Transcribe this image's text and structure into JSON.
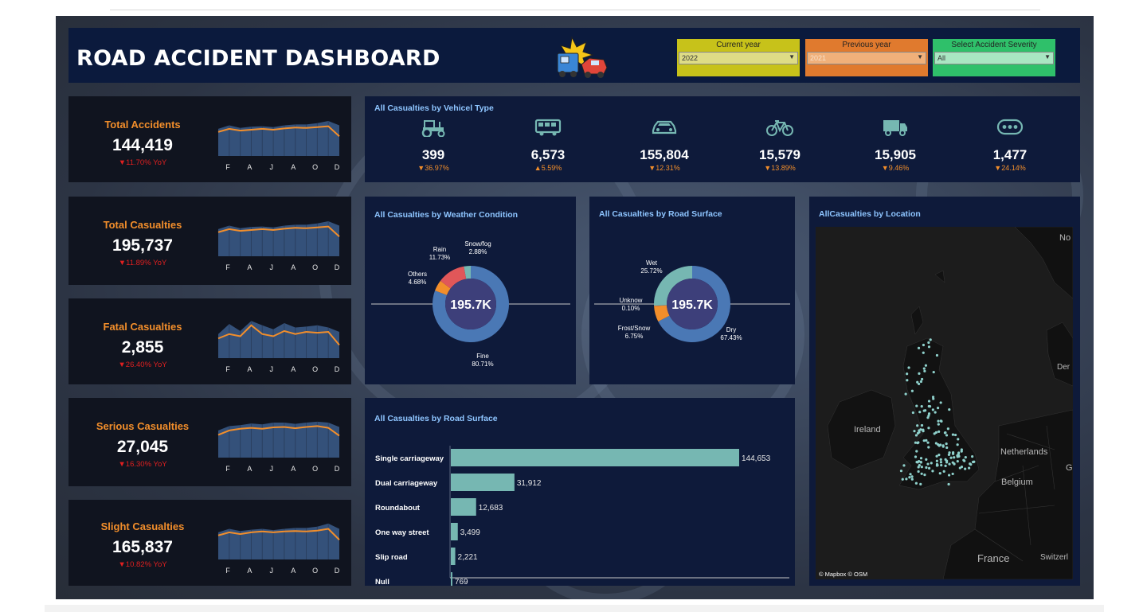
{
  "title": "ROAD ACCIDENT DASHBOARD",
  "header_icon": "car-crash-icon",
  "filters": [
    {
      "label": "Current year",
      "value": "2022",
      "color": "#c7c21a"
    },
    {
      "label": "Previous year",
      "value": "2021",
      "color": "#e07a2e"
    },
    {
      "label": "Select Accident Severity",
      "value": "All",
      "color": "#2fc06a"
    }
  ],
  "kpis": [
    {
      "title": "Total Accidents",
      "value": "144,419",
      "yoy": "▼11.70%  YoY",
      "trend": [
        0.55,
        0.62,
        0.58,
        0.6,
        0.62,
        0.6,
        0.63,
        0.65,
        0.64,
        0.66,
        0.68,
        0.45
      ],
      "area": [
        0.62,
        0.7,
        0.64,
        0.67,
        0.68,
        0.66,
        0.7,
        0.72,
        0.72,
        0.75,
        0.8,
        0.7
      ]
    },
    {
      "title": "Total Casualties",
      "value": "195,737",
      "yoy": "▼11.89%  YoY",
      "trend": [
        0.55,
        0.62,
        0.58,
        0.6,
        0.62,
        0.6,
        0.63,
        0.65,
        0.64,
        0.66,
        0.68,
        0.45
      ],
      "area": [
        0.62,
        0.7,
        0.64,
        0.67,
        0.68,
        0.66,
        0.7,
        0.72,
        0.72,
        0.75,
        0.8,
        0.7
      ]
    },
    {
      "title": "Fatal Casualties",
      "value": "2,855",
      "yoy": "▼26.40%  YoY",
      "trend": [
        0.45,
        0.55,
        0.5,
        0.75,
        0.55,
        0.5,
        0.62,
        0.55,
        0.6,
        0.58,
        0.6,
        0.3
      ],
      "area": [
        0.55,
        0.78,
        0.62,
        0.85,
        0.75,
        0.66,
        0.8,
        0.7,
        0.72,
        0.75,
        0.7,
        0.6
      ]
    },
    {
      "title": "Serious Casualties",
      "value": "27,045",
      "yoy": "▼16.30%  YoY",
      "trend": [
        0.52,
        0.62,
        0.66,
        0.68,
        0.66,
        0.69,
        0.7,
        0.67,
        0.7,
        0.72,
        0.68,
        0.5
      ],
      "area": [
        0.62,
        0.72,
        0.74,
        0.78,
        0.76,
        0.8,
        0.8,
        0.77,
        0.8,
        0.82,
        0.8,
        0.7
      ]
    },
    {
      "title": "Slight Casualties",
      "value": "165,837",
      "yoy": "▼10.82%  YoY",
      "trend": [
        0.55,
        0.62,
        0.58,
        0.62,
        0.64,
        0.62,
        0.64,
        0.65,
        0.64,
        0.66,
        0.7,
        0.45
      ],
      "area": [
        0.62,
        0.7,
        0.65,
        0.68,
        0.7,
        0.67,
        0.7,
        0.72,
        0.72,
        0.75,
        0.82,
        0.7
      ]
    }
  ],
  "spark_months": [
    "F",
    "A",
    "J",
    "A",
    "O",
    "D"
  ],
  "vehicles": {
    "title": "All Casualties by Vehicel Type",
    "items": [
      {
        "icon": "tractor-icon",
        "value": "399",
        "yoy": "▼36.97%"
      },
      {
        "icon": "bus-icon",
        "value": "6,573",
        "yoy": "▲5.59%"
      },
      {
        "icon": "car-icon",
        "value": "155,804",
        "yoy": "▼12.31%"
      },
      {
        "icon": "bicycle-icon",
        "value": "15,579",
        "yoy": "▼13.89%"
      },
      {
        "icon": "van-icon",
        "value": "15,905",
        "yoy": "▼9.46%"
      },
      {
        "icon": "other-icon",
        "value": "1,477",
        "yoy": "▼24.14%"
      }
    ]
  },
  "donut_center": "195.7K",
  "chart_data": [
    {
      "type": "pie",
      "title": "All Casualties by Weather Condition",
      "slices": [
        {
          "label": "Fine",
          "pct_label": "80.71%",
          "value": 80.71,
          "color": "#4a78b5"
        },
        {
          "label": "Others",
          "pct_label": "4.68%",
          "value": 4.68,
          "color": "#f28e2b"
        },
        {
          "label": "Rain",
          "pct_label": "11.73%",
          "value": 11.73,
          "color": "#e15759"
        },
        {
          "label": "Snow/fog",
          "pct_label": "2.88%",
          "value": 2.88,
          "color": "#76b7b2"
        }
      ]
    },
    {
      "type": "pie",
      "title": "All Casualties by Road Surface",
      "slices": [
        {
          "label": "Dry",
          "pct_label": "67.43%",
          "value": 67.43,
          "color": "#4a78b5"
        },
        {
          "label": "Frost/Snow",
          "pct_label": "6.75%",
          "value": 6.75,
          "color": "#f28e2b"
        },
        {
          "label": "Unknow",
          "pct_label": "0.10%",
          "value": 0.1,
          "color": "#e15759"
        },
        {
          "label": "Wet",
          "pct_label": "25.72%",
          "value": 25.72,
          "color": "#76b7b2"
        }
      ]
    },
    {
      "type": "bar",
      "title": "All Casualties by Road Surface",
      "categories": [
        "Single carriageway",
        "Dual carriageway",
        "Roundabout",
        "One way street",
        "Slip road",
        "Null"
      ],
      "values": [
        144653,
        31912,
        12683,
        3499,
        2221,
        769
      ],
      "value_labels": [
        "144,653",
        "31,912",
        "12,683",
        "3,499",
        "2,221",
        "769"
      ],
      "color": "#76b7b2"
    }
  ],
  "map": {
    "title": "AllCasualties by Location",
    "labels": [
      "Ireland",
      "Netherlands",
      "Belgium",
      "France",
      "Switzerl",
      "No",
      "Der",
      "G"
    ],
    "attribution": "© Mapbox  © OSM"
  }
}
